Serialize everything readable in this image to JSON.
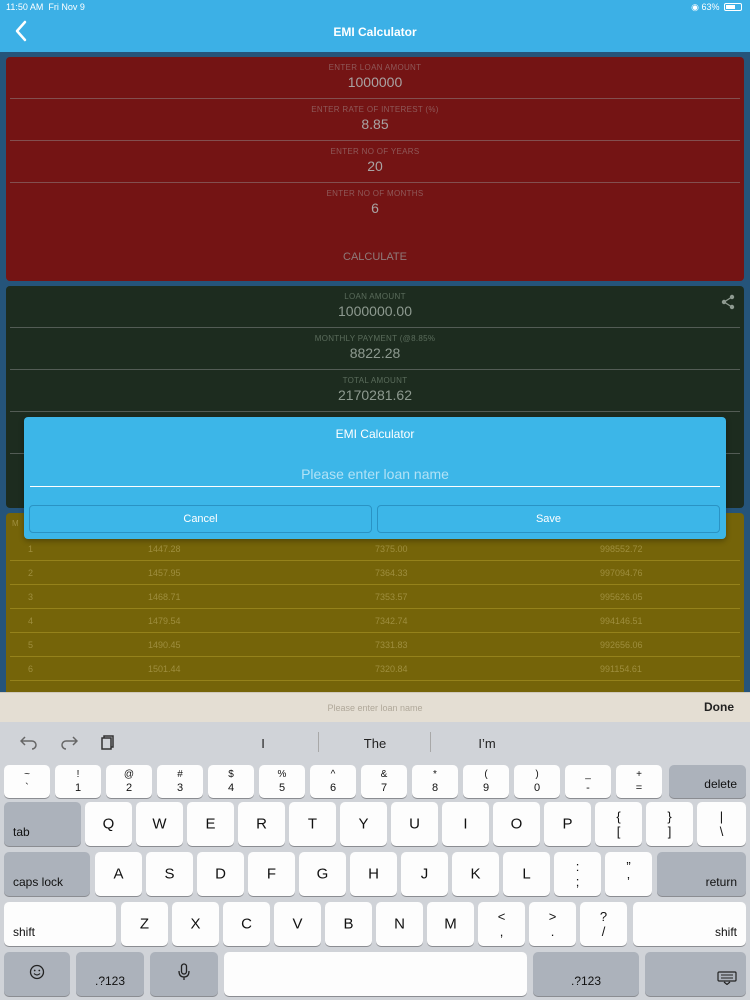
{
  "status": {
    "time": "11:50 AM",
    "date": "Fri Nov 9",
    "battery": "63%"
  },
  "nav": {
    "back_icon": "chevron-left-icon",
    "title": "EMI Calculator"
  },
  "input_panel": {
    "fields": [
      {
        "label": "ENTER LOAN AMOUNT",
        "value": "1000000"
      },
      {
        "label": "ENTER RATE OF INTEREST (%)",
        "value": "8.85"
      },
      {
        "label": "ENTER NO OF YEARS",
        "value": "20"
      },
      {
        "label": "ENTER NO OF MONTHS",
        "value": "6"
      }
    ],
    "calculate_label": "CALCULATE"
  },
  "result_panel": {
    "fields": [
      {
        "label": "LOAN AMOUNT",
        "value": "1000000.00"
      },
      {
        "label": "MONTHLY PAYMENT (@8.85%",
        "value": "8822.28"
      },
      {
        "label": "TOTAL AMOUNT",
        "value": "2170281.62"
      }
    ]
  },
  "schedule": {
    "header_first": "M",
    "rows": [
      [
        "1",
        "1447.28",
        "7375.00",
        "998552.72"
      ],
      [
        "2",
        "1457.95",
        "7364.33",
        "997094.76"
      ],
      [
        "3",
        "1468.71",
        "7353.57",
        "995626.05"
      ],
      [
        "4",
        "1479.54",
        "7342.74",
        "994146.51"
      ],
      [
        "5",
        "1490.45",
        "7331.83",
        "992656.06"
      ],
      [
        "6",
        "1501.44",
        "7320.84",
        "991154.61"
      ]
    ]
  },
  "alert": {
    "title": "EMI Calculator",
    "input_placeholder": "Please enter loan name",
    "input_value": "",
    "cancel_label": "Cancel",
    "save_label": "Save"
  },
  "accessory": {
    "placeholder": "Please enter loan name",
    "done_label": "Done"
  },
  "keyboard": {
    "suggestions": [
      "I",
      "The",
      "I’m"
    ],
    "number_row": [
      [
        "~",
        "`"
      ],
      [
        "!",
        "1"
      ],
      [
        "@",
        "2"
      ],
      [
        "#",
        "3"
      ],
      [
        "$",
        "4"
      ],
      [
        "%",
        "5"
      ],
      [
        "^",
        "6"
      ],
      [
        "&",
        "7"
      ],
      [
        "*",
        "8"
      ],
      [
        "(",
        "9"
      ],
      [
        ")",
        "0"
      ],
      [
        "_",
        "-"
      ],
      [
        "+",
        "="
      ]
    ],
    "delete_label": "delete",
    "tab_label": "tab",
    "row1": [
      "Q",
      "W",
      "E",
      "R",
      "T",
      "Y",
      "U",
      "I",
      "O",
      "P"
    ],
    "row1_symbols": [
      [
        "{",
        "["
      ],
      [
        "}",
        "]"
      ],
      [
        "|",
        "\\"
      ]
    ],
    "caps_label": "caps lock",
    "row2": [
      "A",
      "S",
      "D",
      "F",
      "G",
      "H",
      "J",
      "K",
      "L"
    ],
    "row2_symbols": [
      [
        ":",
        ";"
      ],
      [
        "”",
        "’"
      ]
    ],
    "return_label": "return",
    "shift_label": "shift",
    "row3": [
      "Z",
      "X",
      "C",
      "V",
      "B",
      "N",
      "M"
    ],
    "row3_symbols": [
      [
        "<",
        ","
      ],
      [
        ">",
        "."
      ],
      [
        "?",
        "/"
      ]
    ],
    "numbers_label": ".?123",
    "emoji_icon": "emoji-icon",
    "mic_icon": "microphone-icon",
    "dismiss_icon": "keyboard-dismiss-icon"
  }
}
